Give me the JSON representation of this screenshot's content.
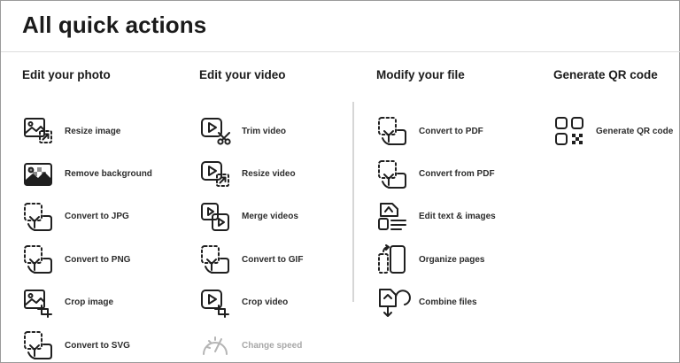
{
  "title": "All quick actions",
  "columns": [
    {
      "heading": "Edit your photo",
      "items": [
        {
          "label": "Resize image",
          "icon": "resize-image-icon"
        },
        {
          "label": "Remove background",
          "icon": "remove-background-icon"
        },
        {
          "label": "Convert to JPG",
          "icon": "convert-file-icon"
        },
        {
          "label": "Convert to PNG",
          "icon": "convert-file-icon"
        },
        {
          "label": "Crop image",
          "icon": "crop-image-icon"
        },
        {
          "label": "Convert to SVG",
          "icon": "convert-file-icon"
        }
      ]
    },
    {
      "heading": "Edit your video",
      "items": [
        {
          "label": "Trim video",
          "icon": "trim-video-icon"
        },
        {
          "label": "Resize video",
          "icon": "resize-video-icon"
        },
        {
          "label": "Merge videos",
          "icon": "merge-videos-icon"
        },
        {
          "label": "Convert to GIF",
          "icon": "convert-file-icon"
        },
        {
          "label": "Crop video",
          "icon": "crop-video-icon"
        },
        {
          "label": "Change speed",
          "icon": "change-speed-icon",
          "disabled": true
        }
      ]
    },
    {
      "heading": "Modify your file",
      "items": [
        {
          "label": "Convert to PDF",
          "icon": "convert-file-icon"
        },
        {
          "label": "Convert from PDF",
          "icon": "convert-file-icon"
        },
        {
          "label": "Edit text & images",
          "icon": "edit-text-images-icon"
        },
        {
          "label": "Organize pages",
          "icon": "organize-pages-icon"
        },
        {
          "label": "Combine files",
          "icon": "combine-files-icon"
        }
      ]
    },
    {
      "heading": "Generate QR code",
      "items": [
        {
          "label": "Generate QR code",
          "icon": "qr-code-icon"
        }
      ]
    }
  ]
}
